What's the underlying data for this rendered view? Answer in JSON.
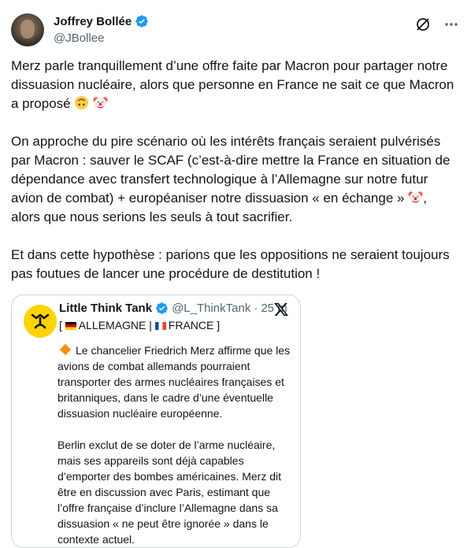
{
  "author": {
    "display_name": "Joffrey Bollée",
    "handle": "@JBollee"
  },
  "tweet": {
    "p1_text": "Merz parle tranquillement d’une offre faite par Macron pour partager notre dissuasion nucléaire, alors que personne en France ne sait ce que Macron a proposé",
    "p2_text": "On approche du pire scénario où les intérêts français seraient pulvérisés par Macron : sauver le SCAF (c’est-à-dire mettre la France en situation de dépendance avec transfert technologique à l’Allemagne sur notre futur avion de combat) + européaniser notre dissuasion « en échange »",
    "p2_tail": ", alors que nous serions les seuls à tout sacrifier.",
    "p3_text": "Et dans cette hypothèse : parions que les oppositions ne seraient toujours pas foutues de lancer une procédure de destitution !"
  },
  "quote": {
    "display_name": "Little Think Tank",
    "handle": "@L_ThinkTank",
    "separator": "·",
    "time": "25 m",
    "flags_open": "[",
    "country1": "ALLEMAGNE",
    "divider": "|",
    "country2": "FRANCE",
    "flags_close": "]",
    "p1_text": "Le chancelier Friedrich Merz affirme que les avions de combat allemands pourraient transporter des armes nucléaires françaises et britanniques, dans le cadre d’une éventuelle dissuasion nucléaire européenne.",
    "p2_text": "Berlin exclut de se doter de l’arme nucléaire, mais ses appareils sont déjà capables d’emporter des bombes américaines. Merz dit être en discussion avec Paris, estimant que l’offre française d’inclure l’Allemagne dans sa dissuasion « ne peut être ignorée » dans le contexte actuel."
  },
  "icons": {
    "verified": "verified-badge-icon",
    "grok": "grok-icon",
    "more": "more-icon",
    "x_logo": "x-logo-icon",
    "upside_down": "upside-down-face-emoji",
    "clown": "clown-face-emoji",
    "diamond": "orange-diamond-emoji"
  },
  "colors": {
    "verified_blue": "#1d9bf0",
    "muted_text": "#536471",
    "border": "#cfd9de",
    "ltt_yellow": "#ffd400"
  }
}
